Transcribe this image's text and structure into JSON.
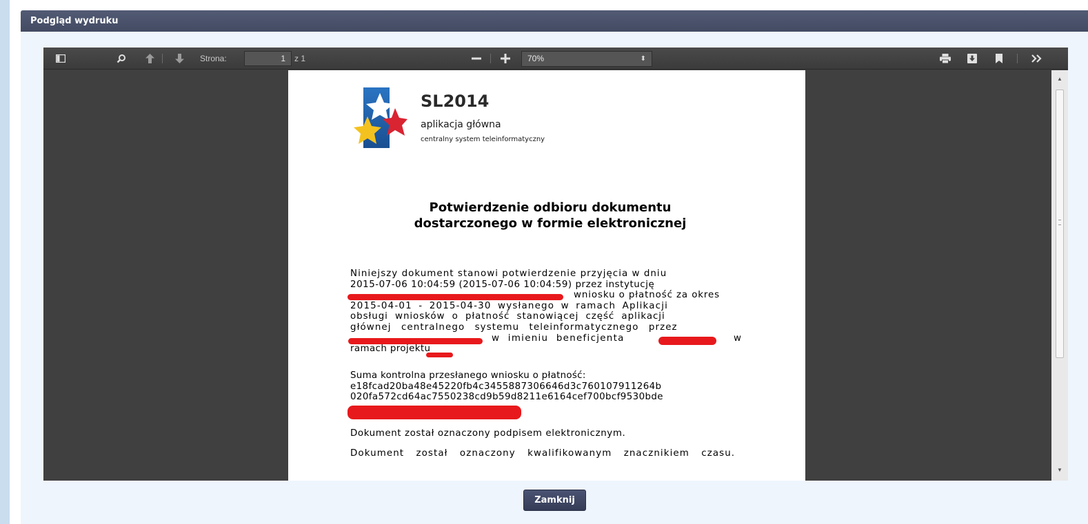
{
  "dialog": {
    "title": "Podgląd wydruku",
    "close_label": "Zamknij"
  },
  "viewer": {
    "page_label": "Strona:",
    "page_value": "1",
    "page_of": "z 1",
    "zoom_value": "70%",
    "icons": [
      "sidebar-toggle-icon",
      "search-icon",
      "previous-page-icon",
      "next-page-icon",
      "zoom-out-icon",
      "zoom-in-icon",
      "print-icon",
      "download-icon",
      "bookmark-icon",
      "tools-icon"
    ]
  },
  "document": {
    "brand": "SL2014",
    "brand_subtitle": "aplikacja główna",
    "brand_tagline": "centralny system teleinformatyczny",
    "title_line1": "Potwierdzenie odbioru dokumentu",
    "title_line2": "dostarczonego w formie elektronicznej",
    "para1_lines": [
      "Niniejszy dokument stanowi potwierdzenie przyjęcia w dniu",
      "2015-07-06 10:04:59 (2015-07-06 10:04:59) przez instytucję",
      "wniosku o płatność za okres",
      "2015-04-01 - 2015-04-30 wysłanego w ramach Aplikacji",
      "obsługi wniosków o płatność stanowiącej część aplikacji",
      "głównej centralnego systemu teleinformatycznego przez",
      "w imieniu beneficjenta",
      "w",
      "ramach projektu"
    ],
    "checksum_label": "Suma kontrolna przesłanego wniosku o płatność:",
    "checksum_line1": "e18fcad20ba48e45220fb4c3455887306646d3c760107911264b",
    "checksum_line2": "020fa572cd64ac7550238cd9b59d8211e6164cef700bcf9530bde",
    "signature_note": "Dokument został oznaczony podpisem elektronicznym.",
    "timestamp_note": "Dokument został oznaczony kwalifikowanym znacznikiem czasu."
  },
  "colors": {
    "header_bg": "#4a526b",
    "viewer_bg": "#404040",
    "redaction": "#e8191c",
    "button_bg": "#3f4764"
  }
}
